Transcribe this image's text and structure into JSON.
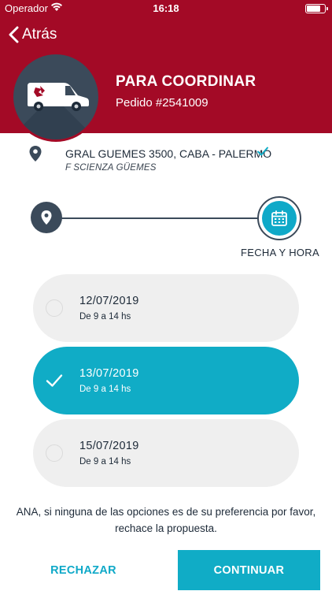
{
  "status_bar": {
    "carrier": "Operador",
    "time": "16:18"
  },
  "nav": {
    "back_label": "Atrás"
  },
  "header": {
    "title": "PARA COORDINAR",
    "order": "Pedido #2541009"
  },
  "address": {
    "line": "GRAL GUEMES 3500, CABA - PALERMO",
    "sub": "F SCIENZA GÜEMES",
    "verified": true
  },
  "steps": {
    "current_label": "FECHA Y HORA"
  },
  "options": [
    {
      "date": "12/07/2019",
      "time": "De 9 a 14 hs",
      "selected": false
    },
    {
      "date": "13/07/2019",
      "time": "De 9 a 14 hs",
      "selected": true
    },
    {
      "date": "15/07/2019",
      "time": "De 9 a 14 hs",
      "selected": false
    }
  ],
  "notice": "ANA, si ninguna de las opciones es de su preferencia por favor, rechace la propuesta.",
  "actions": {
    "reject": "RECHAZAR",
    "continue": "CONTINUAR"
  },
  "colors": {
    "brand_red": "#a30a26",
    "accent": "#10acc6",
    "dark": "#3b4a5a"
  },
  "icons": [
    "wifi-icon",
    "battery-icon",
    "back-chevron-icon",
    "van-icon",
    "location-pin-icon",
    "check-icon",
    "calendar-icon"
  ]
}
